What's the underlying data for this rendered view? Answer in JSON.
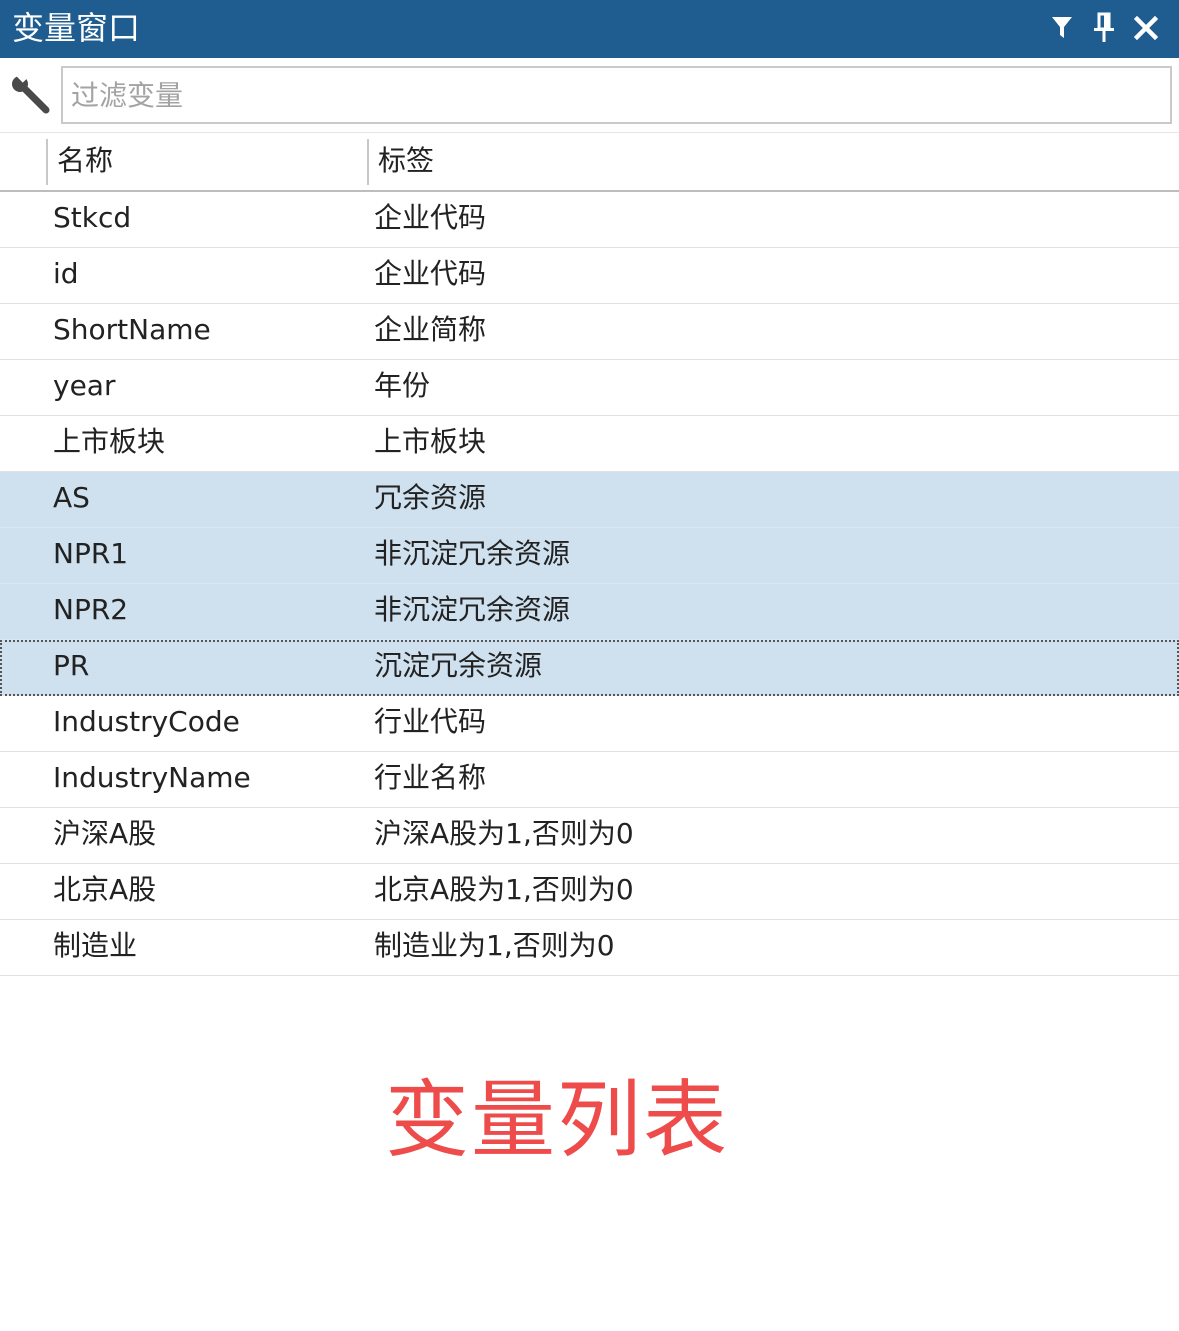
{
  "window": {
    "title": "变量窗口",
    "buttons": {
      "filter_icon": "funnel-icon",
      "pin_icon": "pin-icon",
      "close_icon": "close-icon"
    },
    "titlebar_color": "#1f5c8f"
  },
  "filter": {
    "icon": "wrench-icon",
    "placeholder": "过滤变量",
    "value": ""
  },
  "table": {
    "columns": [
      "名称",
      "标签"
    ],
    "rows": [
      {
        "name": "Stkcd",
        "label": "企业代码"
      },
      {
        "name": "id",
        "label": "企业代码"
      },
      {
        "name": "ShortName",
        "label": "企业简称"
      },
      {
        "name": "year",
        "label": "年份"
      },
      {
        "name": "上市板块",
        "label": "上市板块"
      },
      {
        "name": "AS",
        "label": "冗余资源"
      },
      {
        "name": "NPR1",
        "label": "非沉淀冗余资源"
      },
      {
        "name": "NPR2",
        "label": "非沉淀冗余资源"
      },
      {
        "name": "PR",
        "label": "沉淀冗余资源"
      },
      {
        "name": "IndustryCode",
        "label": "行业代码"
      },
      {
        "name": "IndustryName",
        "label": "行业名称"
      },
      {
        "name": "沪深A股",
        "label": "沪深A股为1,否则为0"
      },
      {
        "name": "北京A股",
        "label": "北京A股为1,否则为0"
      },
      {
        "name": "制造业",
        "label": "制造业为1,否则为0"
      }
    ],
    "selected_rows": [
      "AS",
      "NPR1",
      "NPR2",
      "PR"
    ],
    "focused_row": "PR",
    "selection_color": "#cfe0ef"
  },
  "caption": {
    "text": "变量列表",
    "color": "#ee4b4b"
  }
}
